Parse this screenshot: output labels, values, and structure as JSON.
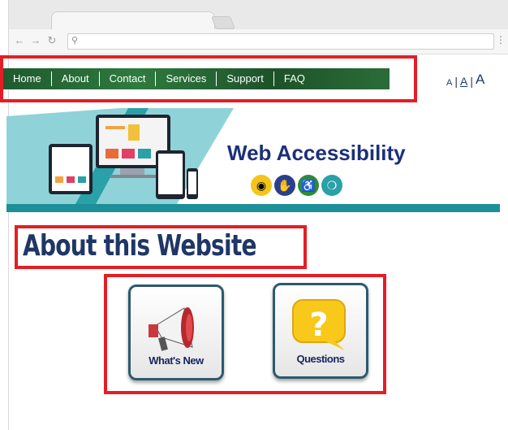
{
  "browser": {
    "back_icon": "back-arrow-icon",
    "forward_icon": "forward-arrow-icon",
    "reload_icon": "reload-icon",
    "search_icon": "search-icon"
  },
  "site_nav": {
    "items": [
      "Home",
      "About",
      "Contact",
      "Services",
      "Support",
      "FAQ"
    ]
  },
  "font_size_controls": {
    "small": "A",
    "medium": "A",
    "large": "A",
    "separator": "|"
  },
  "banner": {
    "title": "Web Accessibility",
    "icons": [
      "eye-icon",
      "sign-language-icon",
      "wheelchair-icon",
      "hearing-icon"
    ]
  },
  "page": {
    "heading": "About this Website"
  },
  "tiles": [
    {
      "label": "What's New",
      "icon": "megaphone-icon"
    },
    {
      "label": "Questions",
      "icon": "question-bubble-icon"
    }
  ],
  "colors": {
    "nav_green": "#2f7a3f",
    "title_navy": "#1b2f7a",
    "heading_navy": "#1f3766",
    "annotation_red": "#e41e26",
    "banner_teal": "#2aa0a8"
  }
}
